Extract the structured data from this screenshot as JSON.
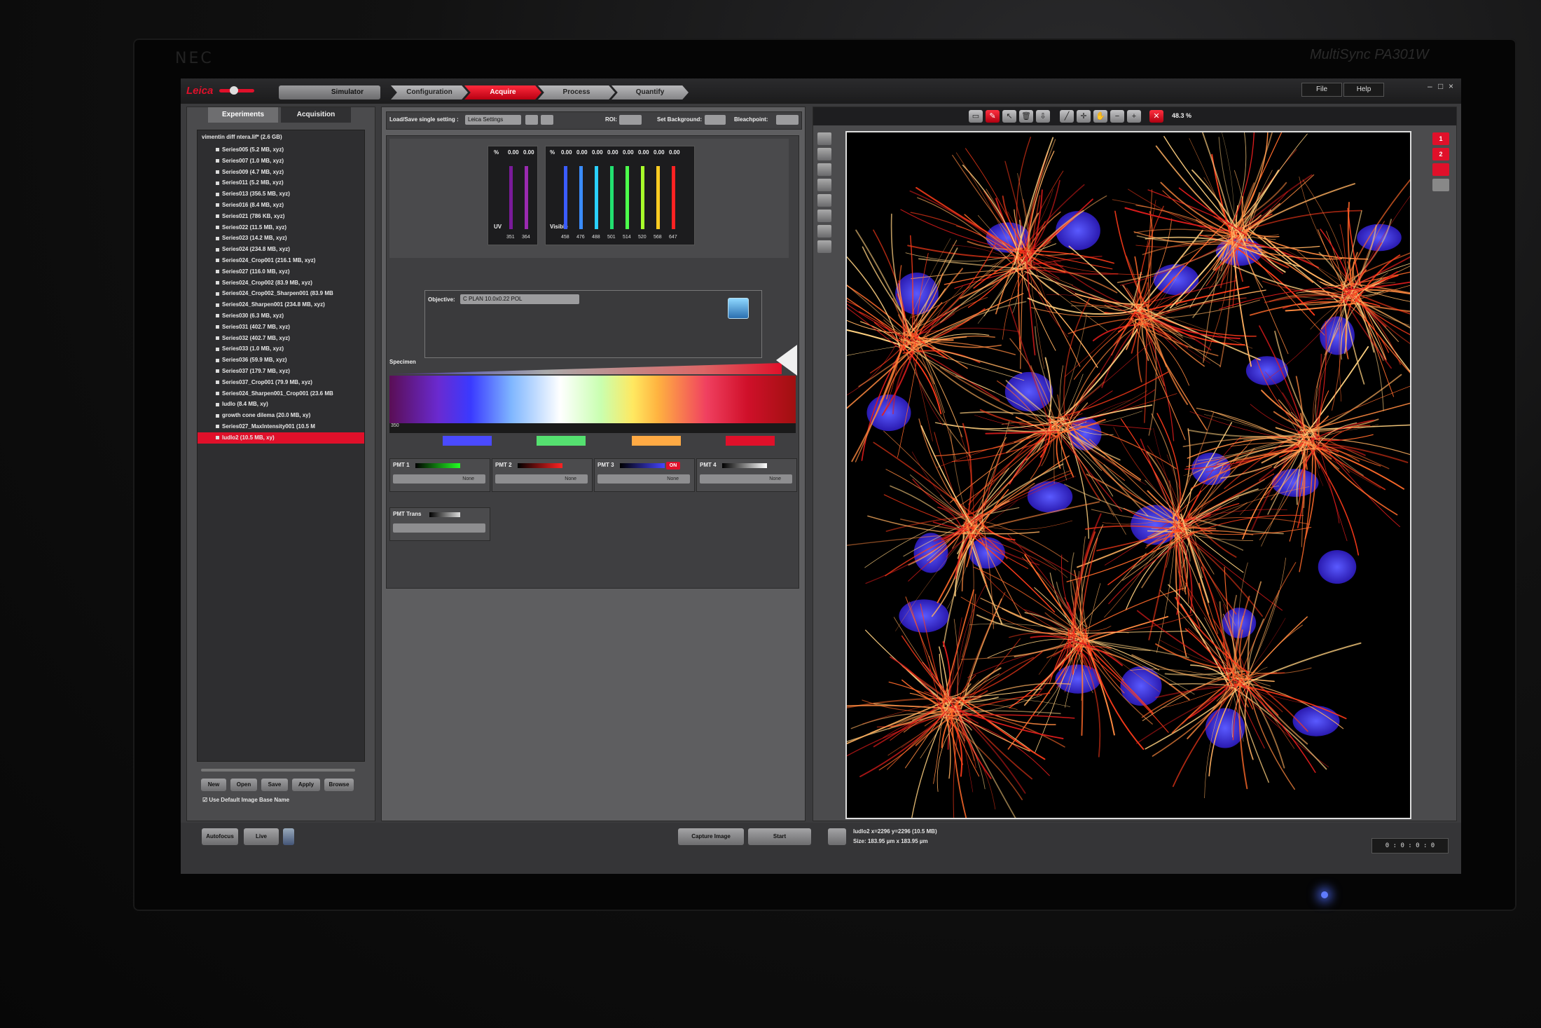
{
  "monitor": {
    "brand": "NEC",
    "model": "MultiSync PA301W"
  },
  "topbar": {
    "logo": "Leica",
    "simulator_label": "Simulator",
    "workflow": [
      "Configuration",
      "Acquire",
      "Process",
      "Quantify"
    ],
    "active_step": "Acquire",
    "menus": [
      "File",
      "Help"
    ],
    "window_controls": [
      "–",
      "□",
      "×"
    ]
  },
  "left_panel": {
    "tabs": [
      "Experiments",
      "Acquisition"
    ],
    "root": "vimentin diff ntera.lif* (2.6 GB)",
    "items": [
      "Series005 (5.2 MB, xyz)",
      "Series007 (1.0 MB, xyz)",
      "Series009 (4.7 MB, xyz)",
      "Series011 (5.2 MB, xyz)",
      "Series013 (356.5 MB, xyz)",
      "Series016 (8.4 MB, xyz)",
      "Series021 (786 KB, xyz)",
      "Series022 (11.5 MB, xyz)",
      "Series023 (14.2 MB, xyz)",
      "Series024 (234.8 MB, xyz)",
      "Series024_Crop001 (216.1 MB, xyz)",
      "Series027 (116.0 MB, xyz)",
      "Series024_Crop002 (83.9 MB, xyz)",
      "Series024_Crop002_Sharpen001 (83.9 MB",
      "Series024_Sharpen001 (234.8 MB, xyz)",
      "Series030 (6.3 MB, xyz)",
      "Series031 (402.7 MB, xyz)",
      "Series032 (402.7 MB, xyz)",
      "Series033 (1.0 MB, xyz)",
      "Series036 (59.9 MB, xyz)",
      "Series037 (179.7 MB, xyz)",
      "Series037_Crop001 (79.9 MB, xyz)",
      "Series024_Sharpen001_Crop001 (23.6 MB",
      "ludlo (8.4 MB, xy)",
      "growth cone dilema (20.0 MB, xy)",
      "Series027_MaxIntensity001 (10.5 M",
      "ludlo2 (10.5 MB, xy)"
    ],
    "selected_index": 26,
    "buttons": [
      "New",
      "Open",
      "Save",
      "Apply",
      "Browse"
    ],
    "checkbox_label": "Use Default Image Base Name"
  },
  "middle_panel": {
    "load_save_label": "Load/Save single setting :",
    "setting_value": "Leica Settings",
    "roi_label": "ROI:",
    "set_background_label": "Set Background:",
    "bleachpoint_label": "Bleachpoint:",
    "uv": {
      "label": "UV",
      "percent_symbol": "%",
      "values": [
        "0.00",
        "0.00"
      ],
      "wavelengths": [
        "351",
        "364"
      ]
    },
    "visible": {
      "label": "Visible",
      "percent_symbol": "%",
      "values": [
        "0.00",
        "0.00",
        "0.00",
        "0.00",
        "0.00",
        "0.00",
        "0.00",
        "0.00"
      ],
      "wavelengths": [
        "458",
        "476",
        "488",
        "501",
        "514",
        "520",
        "568",
        "647"
      ],
      "colors": [
        "#3a5cff",
        "#3a8cff",
        "#2ad0ff",
        "#22e070",
        "#4cff4c",
        "#a8ff2a",
        "#ffcc22",
        "#ff2222"
      ]
    },
    "objective_label": "Objective:",
    "objective_value": "C PLAN 10.0x0.22 POL",
    "specimen_label": "Specimen",
    "pmts": [
      {
        "label": "PMT 1",
        "dropdown": "None",
        "on": ""
      },
      {
        "label": "PMT 2",
        "dropdown": "None",
        "on": ""
      },
      {
        "label": "PMT 3",
        "dropdown": "None",
        "on": "ON"
      },
      {
        "label": "PMT 4",
        "dropdown": "None",
        "on": ""
      }
    ],
    "pmt_trans_label": "PMT Trans",
    "spectrum_start": "350"
  },
  "right_panel": {
    "zoom": "48.3 %",
    "channel_buttons": [
      "1",
      "2"
    ],
    "status_line1": "ludlo2 x=2296 y=2296 (10.5 MB)",
    "status_line2": "Size: 183.95 µm x 183.95 µm"
  },
  "bottom_bar": {
    "autofocus": "Autofocus",
    "live": "Live",
    "capture": "Capture Image",
    "start": "Start",
    "counter": "0 : 0 : 0 : 0"
  },
  "colors": {
    "accent": "#e0102a",
    "panel": "#4b4b4d",
    "dark": "#1e1e20"
  }
}
